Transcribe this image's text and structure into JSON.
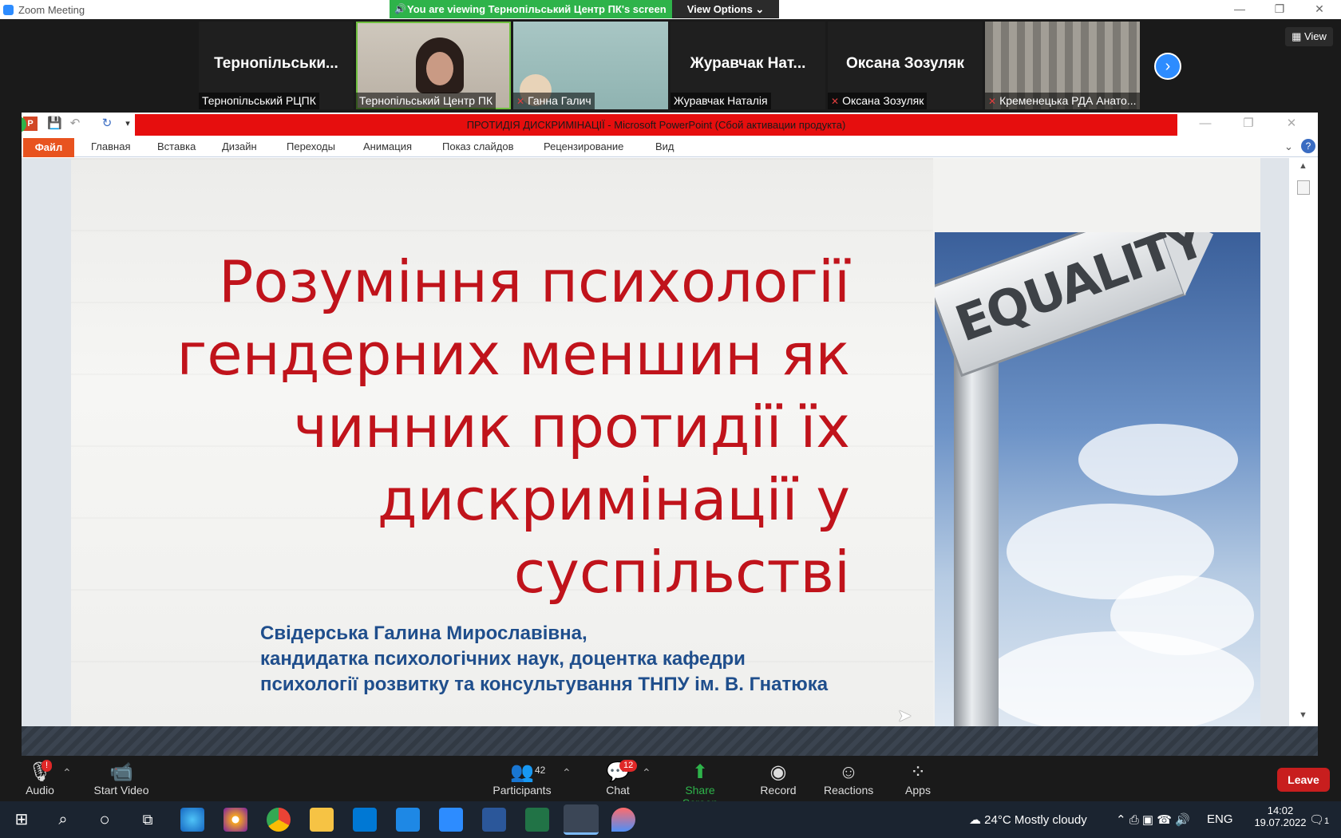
{
  "window": {
    "title": "Zoom Meeting"
  },
  "banner": {
    "text": "You are viewing Тернопільський Центр ПК's screen",
    "view_options": "View Options ⌄"
  },
  "strip": {
    "view_label": "View",
    "tiles": [
      {
        "big": "Тернопільськи...",
        "label": "Тернопільський РЦПК",
        "muted": false
      },
      {
        "big": "",
        "label": "Тернопільський Центр ПК",
        "muted": false
      },
      {
        "big": "",
        "label": "Ганна Галич",
        "muted": true
      },
      {
        "big": "Журавчак Нат...",
        "label": "Журавчак Наталія",
        "muted": false
      },
      {
        "big": "Оксана Зозуляк",
        "label": "Оксана Зозуляк",
        "muted": true
      },
      {
        "big": "",
        "label": "Кременецька РДА Анато...",
        "muted": true
      }
    ]
  },
  "ppt": {
    "title": "ПРОТИДІЯ ДИСКРИМІНАЦІЇ  -  Microsoft PowerPoint (Сбой активации продукта)",
    "tabs": [
      "Файл",
      "Главная",
      "Вставка",
      "Дизайн",
      "Переходы",
      "Анимация",
      "Показ слайдов",
      "Рецензирование",
      "Вид"
    ],
    "slide": {
      "title_lines": [
        "Розуміння психології",
        "гендерних меншин як",
        "чинник протидії їх",
        "дискримінації у суспільстві"
      ],
      "author_lines": [
        "Свідерська Галина Мирославівна,",
        "кандидатка психологічних наук, доцентка кафедри",
        "психології розвитку та консультування ТНПУ ім. В. Гнатюка"
      ],
      "image_word": "EQUALITY"
    }
  },
  "toolbar": {
    "audio": "Audio",
    "video": "Start Video",
    "participants": "Participants",
    "participants_count": "42",
    "chat": "Chat",
    "chat_badge": "12",
    "share": "Share Screen",
    "record": "Record",
    "reactions": "Reactions",
    "apps": "Apps",
    "leave": "Leave",
    "audio_badge": "!"
  },
  "taskbar": {
    "weather": "24°C  Mostly cloudy",
    "lang": "ENG",
    "time": "14:02",
    "date": "19.07.2022",
    "notif": "1"
  },
  "colors": {
    "zoom_blue": "#2d8cff",
    "banner_green": "#2eb34a",
    "ppt_red_bar": "#e60e0e",
    "slide_title": "#c0131b",
    "author": "#1f4e8c"
  }
}
